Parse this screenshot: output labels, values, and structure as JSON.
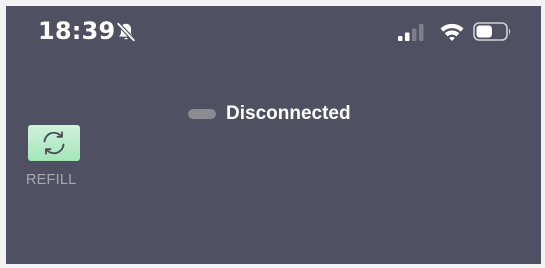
{
  "status_bar": {
    "time": "18:39",
    "mute_icon": "bell-slash-icon",
    "signal_icon": "cellular-signal-icon",
    "wifi_icon": "wifi-icon",
    "battery_icon": "battery-icon",
    "signal_bars_filled": 2,
    "signal_bars_total": 4,
    "battery_level": 0.55
  },
  "connection": {
    "status_text": "Disconnected",
    "indicator_color": "#8a8b93"
  },
  "refill": {
    "label": "REFILL",
    "icon": "refresh-icon",
    "button_color": "#a4e6b9"
  },
  "colors": {
    "background": "#4f5061",
    "text_primary": "#ffffff",
    "text_muted": "#a7a8b3"
  }
}
